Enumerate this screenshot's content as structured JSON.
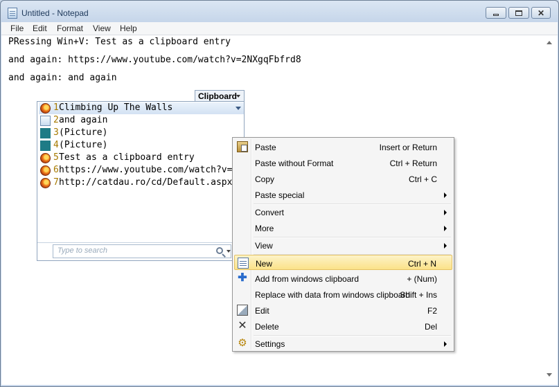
{
  "window": {
    "title": "Untitled - Notepad"
  },
  "menu": [
    "File",
    "Edit",
    "Format",
    "View",
    "Help"
  ],
  "editor": {
    "lines": [
      "PRessing Win+V: Test as a clipboard entry",
      "and again: https://www.youtube.com/watch?v=2NXgqFbfrd8",
      "and again: and again"
    ]
  },
  "clipboard": {
    "tab_label": "Clipboard",
    "items": [
      {
        "num": "1",
        "text": "Climbing Up The Walls",
        "icon": "firefox-icon"
      },
      {
        "num": "2",
        "text": "and again",
        "icon": "notepad-icon"
      },
      {
        "num": "3",
        "text": " (Picture)",
        "icon": "picture-icon"
      },
      {
        "num": "4",
        "text": " (Picture)",
        "icon": "picture-icon"
      },
      {
        "num": "5",
        "text": "Test as a clipboard entry",
        "icon": "firefox-icon"
      },
      {
        "num": "6",
        "text": "https://www.youtube.com/watch?v=",
        "icon": "firefox-icon"
      },
      {
        "num": "7",
        "text": "http://catdau.ro/cd/Default.aspx",
        "icon": "firefox-icon"
      }
    ],
    "search_placeholder": "Type to search"
  },
  "context_menu": {
    "items": [
      {
        "label": "Paste",
        "shortcut": "Insert or Return",
        "icon": "paste-icon"
      },
      {
        "label": "Paste without Format",
        "shortcut": "Ctrl + Return"
      },
      {
        "label": "Copy",
        "shortcut": "Ctrl + C"
      },
      {
        "label": "Paste special",
        "shortcut": "",
        "submenu": true
      },
      {
        "label": "Convert",
        "shortcut": "",
        "submenu": true
      },
      {
        "label": "More",
        "shortcut": "",
        "submenu": true
      },
      {
        "label": "View",
        "shortcut": "",
        "submenu": true
      },
      {
        "label": "New",
        "shortcut": "Ctrl + N",
        "icon": "new-document-icon",
        "highlighted": true
      },
      {
        "label": "Add from windows clipboard",
        "shortcut": "+ (Num)",
        "icon": "plus-icon"
      },
      {
        "label": "Replace with data from windows clipboard",
        "shortcut": "Shift + Ins"
      },
      {
        "label": "Edit",
        "shortcut": "F2",
        "icon": "edit-icon"
      },
      {
        "label": "Delete",
        "shortcut": "Del",
        "icon": "delete-icon"
      },
      {
        "label": "Settings",
        "shortcut": "",
        "icon": "gear-icon",
        "submenu": true
      }
    ]
  }
}
